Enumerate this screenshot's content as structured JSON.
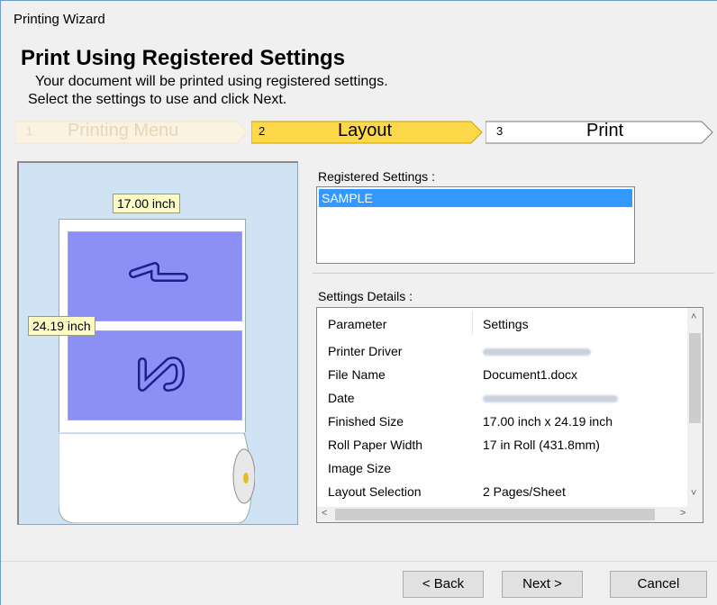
{
  "window": {
    "title": "Printing Wizard"
  },
  "header": {
    "title": "Print Using Registered Settings",
    "subtitle_line1": "Your document will be printed using registered settings.",
    "subtitle_line2": "Select the settings to use and click Next."
  },
  "steps": [
    {
      "num": "1",
      "label": "Printing Menu",
      "state": "completed"
    },
    {
      "num": "2",
      "label": "Layout",
      "state": "active"
    },
    {
      "num": "3",
      "label": "Print",
      "state": "upcoming"
    }
  ],
  "preview": {
    "width_label": "17.00 inch",
    "height_label": "24.19 inch",
    "page_numbers": [
      "1",
      "2"
    ]
  },
  "registered_settings": {
    "label": "Registered Settings :",
    "items": [
      "SAMPLE"
    ],
    "selected": "SAMPLE"
  },
  "settings_details": {
    "label": "Settings Details :",
    "columns": [
      "Parameter",
      "Settings"
    ],
    "rows": [
      {
        "param": "Printer Driver",
        "value": ""
      },
      {
        "param": "File Name",
        "value": "Document1.docx"
      },
      {
        "param": "Date",
        "value": ""
      },
      {
        "param": "Finished Size",
        "value": "17.00 inch x 24.19 inch"
      },
      {
        "param": "Roll Paper Width",
        "value": "17 in Roll (431.8mm)"
      },
      {
        "param": "Image Size",
        "value": ""
      },
      {
        "param": "Layout Selection",
        "value": "2 Pages/Sheet"
      }
    ]
  },
  "buttons": {
    "back": "< Back",
    "next": "Next >",
    "cancel": "Cancel"
  },
  "colors": {
    "step_active": "#fdd94a",
    "step_completed": "#fbf3e2",
    "page_fill": "#8c90f5",
    "selection": "#3399ff"
  }
}
